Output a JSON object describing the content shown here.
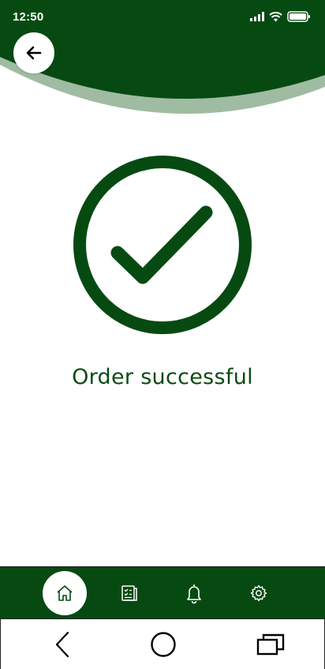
{
  "status_bar": {
    "time": "12:50",
    "icons": [
      "signal-icon",
      "wifi-icon",
      "battery-icon"
    ]
  },
  "header": {
    "back_icon": "arrow-left-icon"
  },
  "main": {
    "success_icon": "check-circle-icon",
    "message": "Order successful"
  },
  "bottom_nav": {
    "items": [
      {
        "icon": "home-icon",
        "active": true
      },
      {
        "icon": "orders-list-icon",
        "active": false
      },
      {
        "icon": "bell-icon",
        "active": false
      },
      {
        "icon": "gear-icon",
        "active": false
      }
    ]
  },
  "system_nav": {
    "items": [
      "back-icon",
      "home-circle-icon",
      "recent-apps-icon"
    ]
  },
  "colors": {
    "primary": "#064a12",
    "header_shadow": "#9fbca3",
    "text_primary": "#0b4b13",
    "background": "#ffffff"
  }
}
